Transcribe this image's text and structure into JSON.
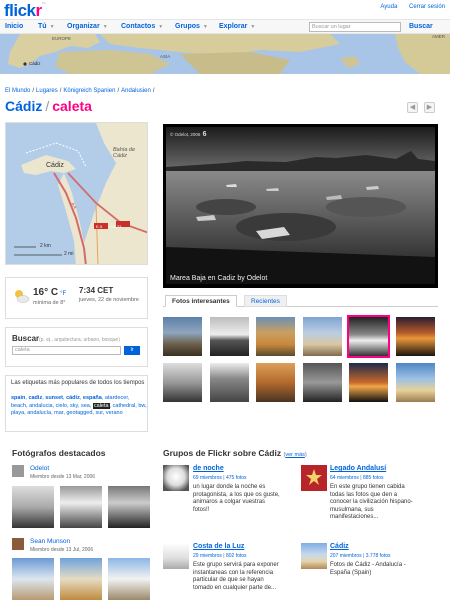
{
  "header": {
    "logo_part1": "flick",
    "logo_part2": "r",
    "logo_tm": "™",
    "top_links": [
      "Ayuda",
      "Cerrar sesión"
    ],
    "nav": [
      "Inicio",
      "Tú",
      "Organizar",
      "Contactos",
      "Grupos",
      "Explorar"
    ],
    "search_placeholder": "Buscar un lugar",
    "search_button": "Buscar"
  },
  "worldmap": {
    "labels": [
      "EUROPE",
      "ASIA",
      "AMER",
      "Cádiz"
    ]
  },
  "breadcrumb": [
    "El Mundo",
    "Lugares",
    "Königreich Spanien",
    "Andalusien"
  ],
  "title": {
    "place": "Cádiz",
    "separator": "/",
    "tag": "caleta"
  },
  "pager": {
    "prev": "◀",
    "next": "▶"
  },
  "localmap": {
    "labels": [
      "Cádiz",
      "Bahía de Cádiz",
      "CA-33",
      "E-5",
      "A-4",
      "2 km",
      "2 mi"
    ]
  },
  "weather": {
    "temp": "16° C",
    "unit_alt": "°F",
    "min": "mínima de 8°",
    "time": "7:34 CET",
    "date": "jueves, 22 de noviembre"
  },
  "search": {
    "title": "Buscar",
    "hint": "(p. ej., arquitectura, urbano, bosque)",
    "value": "caleta",
    "button": "Ir"
  },
  "tags": {
    "title": "Las etiquetas más populares de todos los tiempos",
    "bold": [
      "spain",
      "cadiz",
      "sunset",
      "cádiz",
      "españa"
    ],
    "normal": [
      "atardecer",
      "beach",
      "andalucia",
      "cielo",
      "sky",
      "sea"
    ],
    "highlight": "caleta",
    "more": [
      "cathedral",
      "bw",
      "playa",
      "andalucía",
      "mar",
      "geotagged",
      "sur",
      "verano"
    ]
  },
  "mainphoto": {
    "caption": "Marea Baja en Cadiz by Odelot",
    "credit": "© Odelot, 2006",
    "credit_num": "6"
  },
  "tabs": {
    "active": "Fotos interesantes",
    "inactive": "Recientes"
  },
  "featured": {
    "title": "Fotógrafos destacados",
    "people": [
      {
        "name": "Odelot",
        "since": "Miembro desde 13 Mar, 2006"
      },
      {
        "name": "Sean Munson",
        "since": "Miembro desde 13 Jul, 2006"
      }
    ]
  },
  "groups": {
    "title": "Grupos de Flickr sobre Cádiz",
    "more": "ver más",
    "items": [
      {
        "name": "de noche",
        "members": "69 miembros",
        "photos": "475 fotos",
        "desc": "un lugar donde la noche es protagonista, a los que os guste, animaros a colgar vuestras fotos!!"
      },
      {
        "name": "Legado Andalusí",
        "members": "64 miembros",
        "photos": "885 fotos",
        "desc": "En este grupo tienen cabida todas las fotos que den a conocer la civilización hispano-musulmana, sus manifestaciones..."
      },
      {
        "name": "Costa de la Luz",
        "members": "29 miembros",
        "photos": "802 fotos",
        "desc": "Este grupo servirá para exponer instantaneas con la referencia particular de que se hayan tomado en cualquier parte de..."
      },
      {
        "name": "Cádiz",
        "members": "207 miembros",
        "photos": "3.778 fotos",
        "desc": "Fotos de Cádiz - Andalucía - España (Spain)"
      }
    ]
  }
}
